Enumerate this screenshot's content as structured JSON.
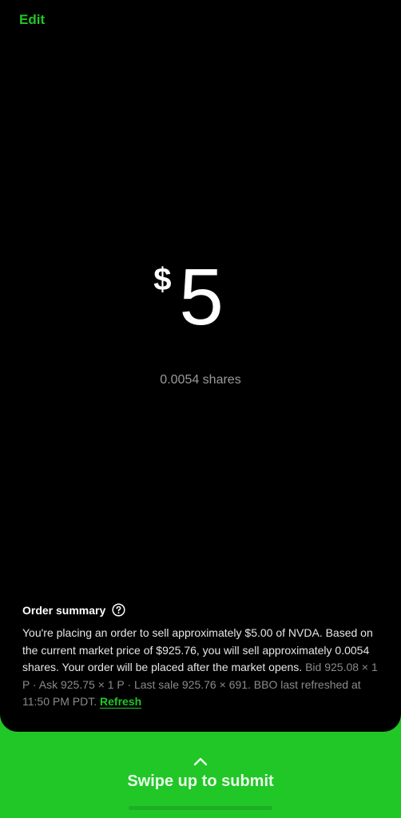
{
  "header": {
    "edit_label": "Edit"
  },
  "amount": {
    "currency_symbol": "$",
    "value": "5",
    "shares": "0.0054 shares"
  },
  "summary": {
    "title": "Order summary",
    "help_icon": "question-circle-icon",
    "body_main": "You're placing an order to sell approximately $5.00 of NVDA. Based on the current market price of $925.76, you will sell approximately 0.0054 shares. Your order will be placed after the market opens.",
    "body_quote": "Bid 925.08 × 1 P · Ask 925.75 × 1 P · Last sale 925.76 × 691. BBO last refreshed at 11:50 PM PDT.",
    "refresh_label": "Refresh"
  },
  "swipe": {
    "icon": "chevron-up-icon",
    "label": "Swipe up to submit"
  },
  "colors": {
    "accent": "#21c627",
    "background": "#000000",
    "muted_text": "#8a8a8a"
  }
}
